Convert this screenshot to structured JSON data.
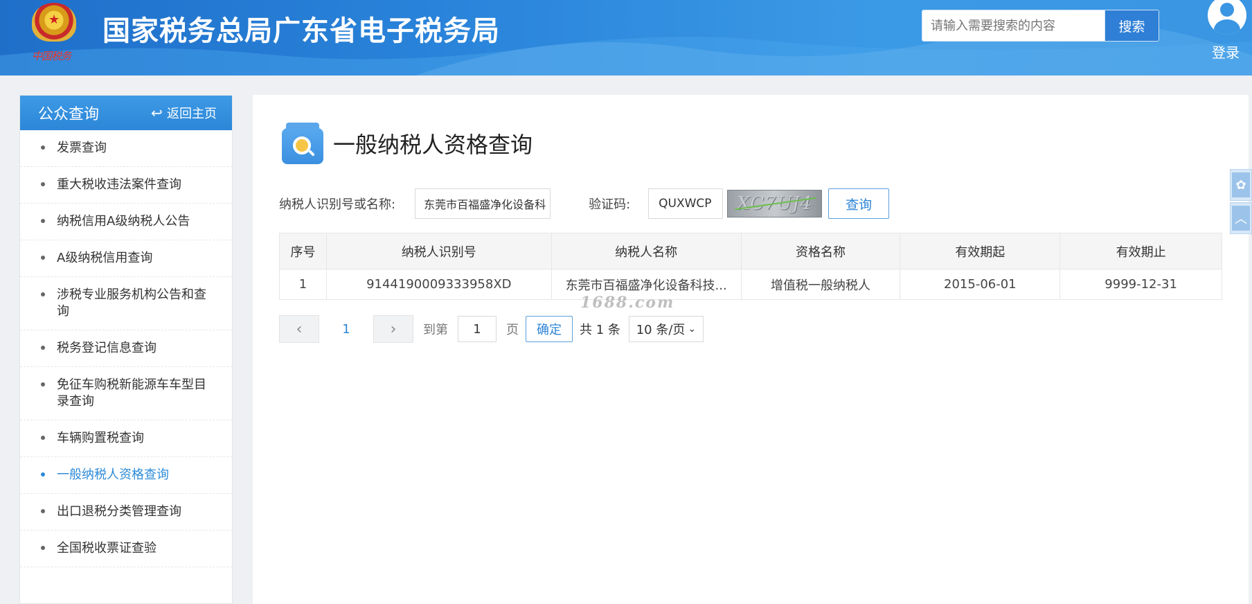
{
  "header": {
    "site_title": "国家税务总局广东省电子税务局",
    "emblem_script": "中国税务",
    "search_placeholder": "请输入需要搜索的内容",
    "search_button": "搜索",
    "login_label": "登录"
  },
  "sidebar": {
    "title": "公众查询",
    "back_label": "返回主页",
    "items": [
      {
        "label": "发票查询"
      },
      {
        "label": "重大税收违法案件查询"
      },
      {
        "label": "纳税信用A级纳税人公告"
      },
      {
        "label": "A级纳税信用查询"
      },
      {
        "label": "涉税专业服务机构公告和查询"
      },
      {
        "label": "税务登记信息查询"
      },
      {
        "label": "免征车购税新能源车车型目录查询"
      },
      {
        "label": "车辆购置税查询"
      },
      {
        "label": "一般纳税人资格查询"
      },
      {
        "label": "出口退税分类管理查询"
      },
      {
        "label": "全国税收票证查验"
      }
    ],
    "active_index": 8
  },
  "main": {
    "page_title": "一般纳税人资格查询",
    "form": {
      "taxpayer_label": "纳税人识别号或名称:",
      "taxpayer_value": "东莞市百福盛净化设备科",
      "captcha_label": "验证码:",
      "captcha_value": "QUXWCP",
      "captcha_image_text": "XC7UJ4",
      "query_button": "查询"
    },
    "table": {
      "headers": [
        "序号",
        "纳税人识别号",
        "纳税人名称",
        "资格名称",
        "有效期起",
        "有效期止"
      ],
      "rows": [
        [
          "1",
          "9144190009333958XD",
          "东莞市百福盛净化设备科技...",
          "增值税一般纳税人",
          "2015-06-01",
          "9999-12-31"
        ]
      ]
    },
    "pager": {
      "prev": "‹",
      "current_page": "1",
      "next": "›",
      "goto_label": "到第",
      "goto_value": "1",
      "page_label": "页",
      "confirm": "确定",
      "total": "共 1 条",
      "page_size": "10 条/页"
    },
    "watermark": "1688.com"
  },
  "colors": {
    "header_blue": "#2b86dc",
    "accent_blue": "#2d85d6",
    "active_item": "#2d8bd8"
  }
}
